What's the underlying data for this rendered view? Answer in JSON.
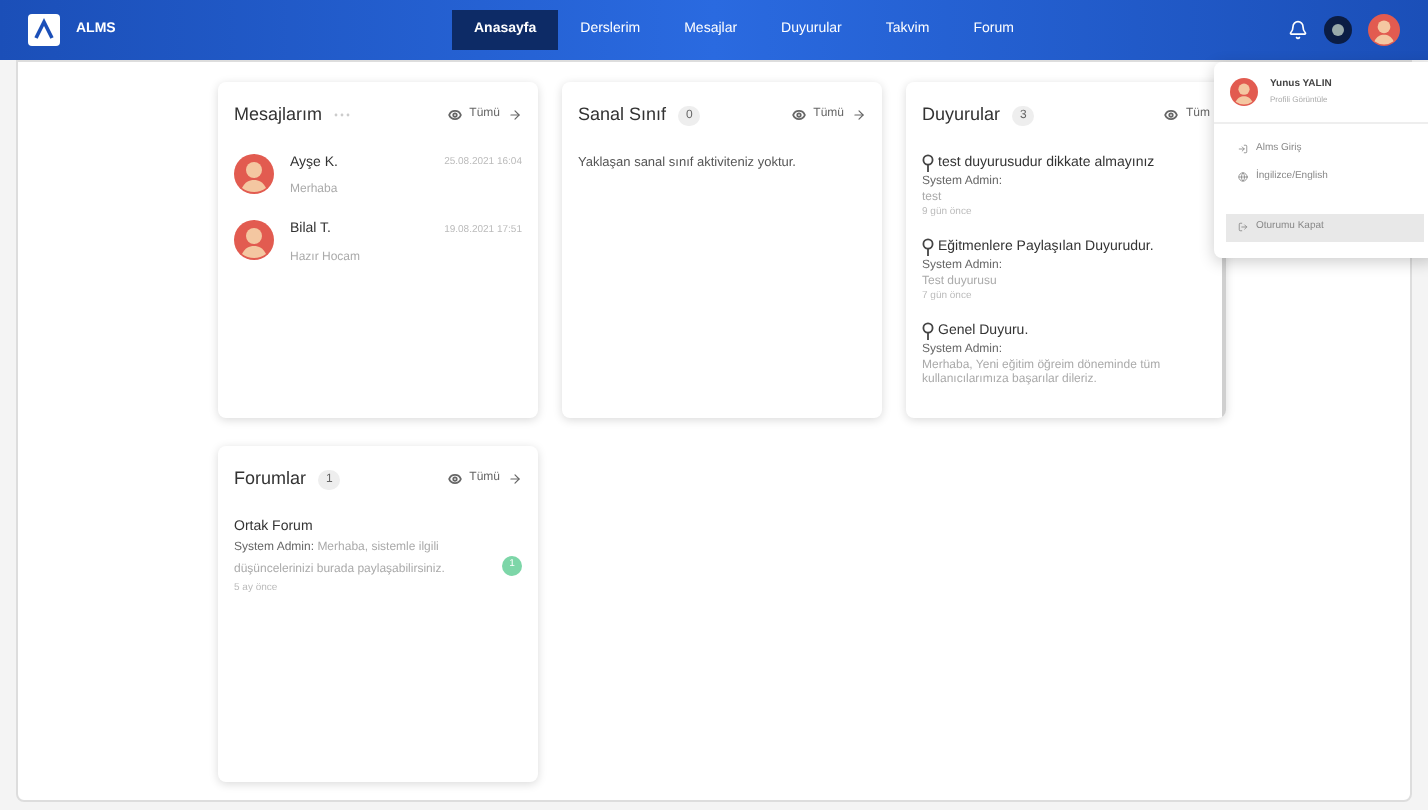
{
  "navbar": {
    "logo_text": "ALMS",
    "items": [
      {
        "label": "Anasayfa",
        "selected": true
      },
      {
        "label": "Derslerim",
        "selected": false
      },
      {
        "label": "Mesajlar",
        "selected": false
      },
      {
        "label": "Duyurular",
        "selected": false
      },
      {
        "label": "Takvim",
        "selected": false
      },
      {
        "label": "Forum",
        "selected": false
      }
    ]
  },
  "messages_card": {
    "title": "Mesajlarım",
    "see_all": "Tümü",
    "arrow": true,
    "items": [
      {
        "name": "Ayşe K.",
        "text": "Merhaba",
        "time": "25.08.2021 16:04"
      },
      {
        "name": "Bilal T.",
        "text": "Hazır Hocam",
        "time": "19.08.2021 17:51"
      }
    ]
  },
  "virtual_class_card": {
    "title": "Sanal Sınıf",
    "count": "0",
    "see_all": "Tümü",
    "arrow": true,
    "empty_text": "Yaklaşan sanal sınıf aktiviteniz yoktur."
  },
  "announcements_card": {
    "title": "Duyurular",
    "count": "3",
    "see_all": "Tüm",
    "arrow": false,
    "items": [
      {
        "title": "test duyurusudur dikkate almayınız",
        "author": "System Admin:",
        "text": "test",
        "time": "9 gün önce"
      },
      {
        "title": "Eğitmenlere Paylaşılan Duyurudur.",
        "author": "System Admin:",
        "text": "Test duyurusu",
        "time": "7 gün önce"
      },
      {
        "title": "Genel Duyuru.",
        "author": "System Admin:",
        "text": "Merhaba,  Yeni eğitim öğreim döneminde tüm kullanıcılarımıza başarılar dileriz."
      }
    ]
  },
  "forums_card": {
    "title": "Forumlar",
    "count": "1",
    "see_all": "Tümü",
    "arrow": true,
    "items": [
      {
        "title": "Ortak Forum",
        "author": "System Admin:",
        "text": "Merhaba, sistemle ilgili düşüncelerinizi burada paylaşabilirsiniz.",
        "time": "5 ay önce",
        "badge": "1"
      }
    ]
  },
  "user_menu": {
    "name": "Yunus YALIN",
    "subtitle": "Profili Görüntüle",
    "items": [
      {
        "kind": "login",
        "label": "Alms Giriş"
      },
      {
        "kind": "language",
        "label": "İngilizce/English"
      },
      {
        "kind": "logout",
        "label": "Oturumu Kapat"
      }
    ]
  }
}
